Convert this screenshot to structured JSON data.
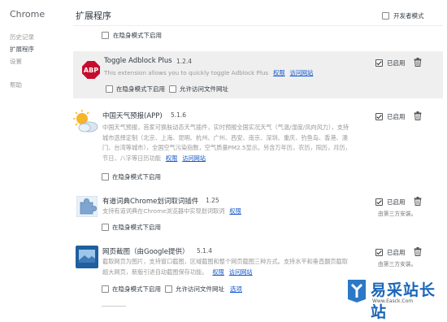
{
  "sidebar": {
    "title": "Chrome",
    "items": [
      {
        "label": "历史记录"
      },
      {
        "label": "扩展程序"
      },
      {
        "label": "设置"
      },
      {
        "label": "帮助"
      }
    ]
  },
  "header": {
    "title": "扩展程序",
    "devmode_label": "开发者模式"
  },
  "common": {
    "incognito_label": "在隐身模式下启用",
    "file_access_label": "允许访问文件网址",
    "enabled_label": "已启用",
    "permissions_label": "权限",
    "visit_label": "访问网站",
    "options_label": "选项",
    "third_party_label": "由第三方安装。"
  },
  "extensions": [
    {
      "name": "Toggle Adblock Plus",
      "version": "1.2.4",
      "desc": "This extension allows you to quickly toggle Adblock Plus",
      "icon": "abp-icon"
    },
    {
      "name": "中国天气预报(APP)",
      "version": "5.1.6",
      "desc_lines": [
        "中国天气预报，首家可换肤动态天气插件，实时预报全国实况天气（气温/湿度/风向风力），支持",
        "城市选择定制（北京、上海、昆明、杭州、广州、西安、南京、深圳、重庆、钓鱼岛、香港、澳",
        "门、台湾等城市），全国空气污染指数，空气质量PM2.5显示。另含万年历，农历，阳历，月历，",
        "节日，八字等日历功能"
      ],
      "icon": "weather-icon"
    },
    {
      "name": "有道词典Chrome划词取词插件",
      "version": "1.25",
      "desc": "支持有道词典在Chrome浏览器中实现划词取词",
      "icon": "puzzle-icon"
    },
    {
      "name": "网页截图（由Google提供）",
      "version": "5.1.4",
      "desc_lines": [
        "截取网页为图片，支持窗口截图，区域截图和整个网页截图三种方式。支持水平和垂直翻页截取",
        "超大网页，新版引进自动截图保存功能。"
      ],
      "icon": "screenshot-icon"
    }
  ],
  "watermark": {
    "text": "易采站长站",
    "url": "Www.Easck.Com"
  }
}
